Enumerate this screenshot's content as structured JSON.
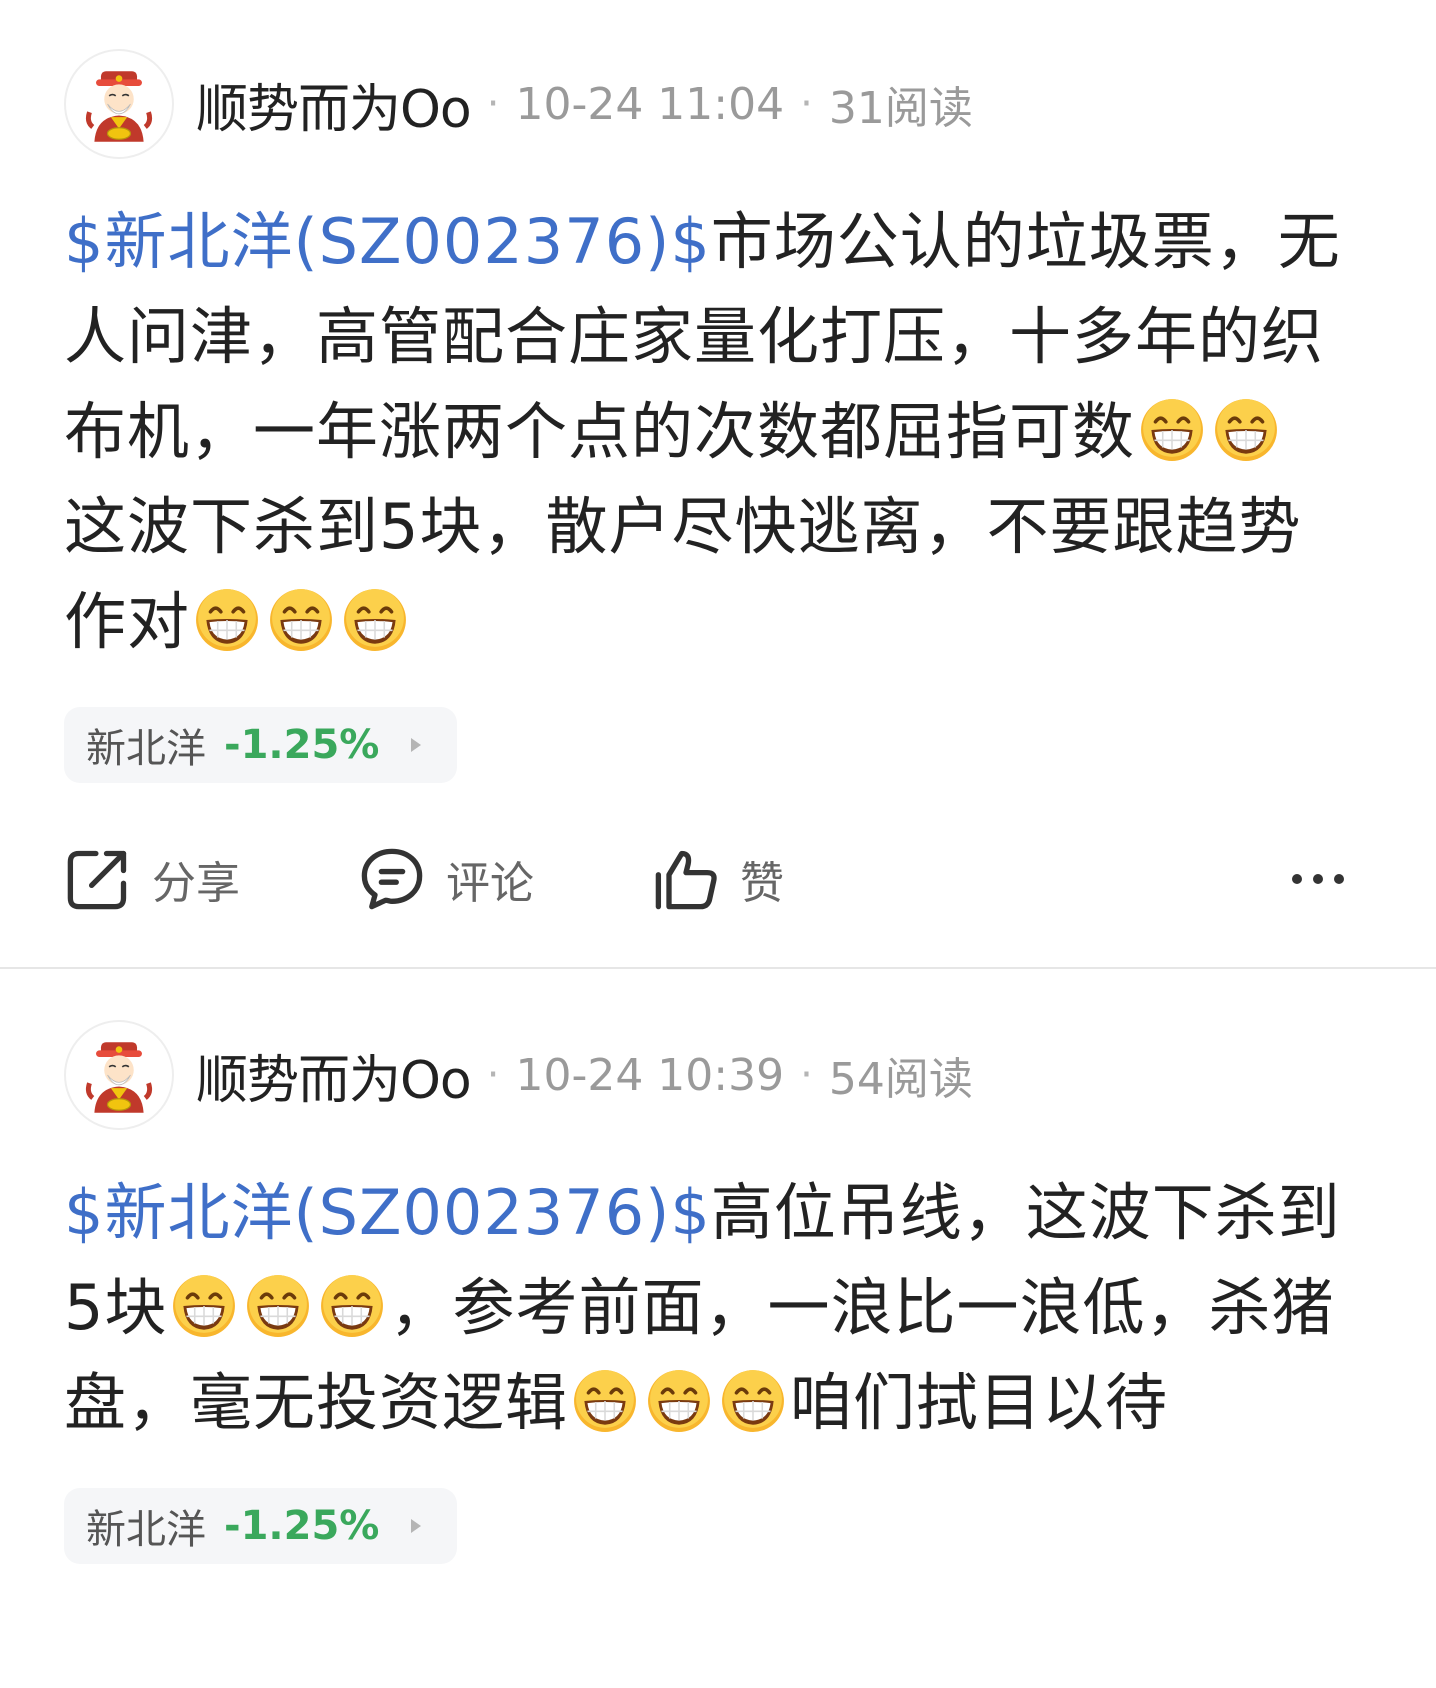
{
  "posts": [
    {
      "author": "顺势而为Oo",
      "date": "10-24 11:04",
      "reads": "31阅读",
      "stock_link": "$新北洋(SZ002376)$",
      "seg1": "市场公认的垃圾票，无人问津，高管配合庄家量化打压，十多年的织布机，一年涨两个点的次数都屈指可数",
      "seg2": "这波下杀到5块，散户尽快逃离，不要跟趋势作对",
      "tag_name": "新北洋",
      "tag_change": "-1.25%"
    },
    {
      "author": "顺势而为Oo",
      "date": "10-24 10:39",
      "reads": "54阅读",
      "stock_link": "$新北洋(SZ002376)$",
      "seg1": "高位吊线，这波下杀到5块",
      "seg2": "，参考前面，一浪比一浪低，杀猪盘，毫无投资逻辑",
      "seg3": "咱们拭目以待",
      "tag_name": "新北洋",
      "tag_change": "-1.25%"
    }
  ],
  "actions": {
    "share": "分享",
    "comment": "评论",
    "like": "赞"
  },
  "colors": {
    "link": "#3f6fc8",
    "change_down": "#3aa85c",
    "meta": "#9a9a9a"
  },
  "icons": {
    "emoji": "grinning-face-icon",
    "share": "share-icon",
    "comment": "comment-icon",
    "like": "thumbs-up-icon",
    "more": "more-icon"
  }
}
